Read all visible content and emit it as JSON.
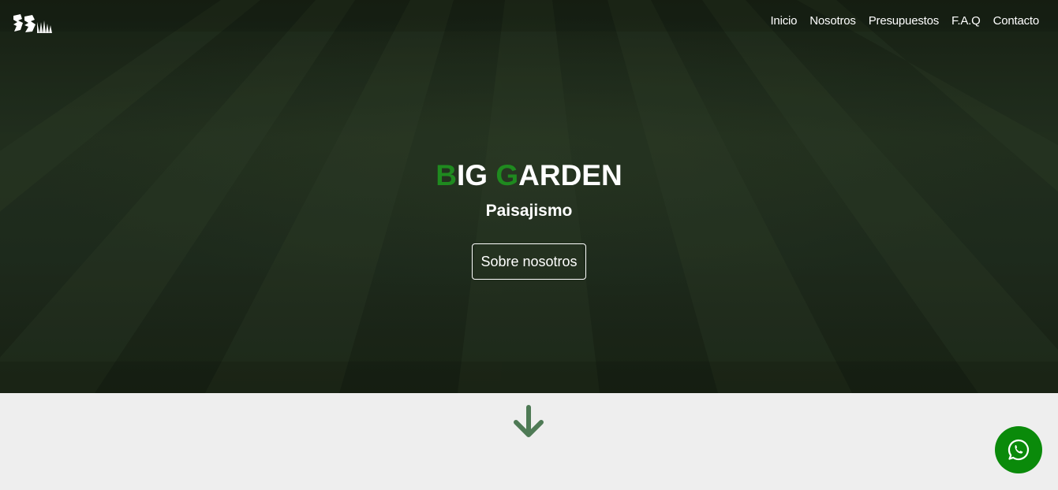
{
  "header": {
    "logo_icon": "big-garden-logo",
    "nav": [
      {
        "label": "Inicio"
      },
      {
        "label": "Nosotros"
      },
      {
        "label": "Presupuestos"
      },
      {
        "label": "F.A.Q"
      },
      {
        "label": "Contacto"
      }
    ]
  },
  "hero": {
    "title_first_initial": "B",
    "title_first_rest": "IG ",
    "title_second_initial": "G",
    "title_second_rest": "ARDEN",
    "subtitle": "Paisajismo",
    "cta_label": "Sobre nosotros"
  },
  "scroll": {
    "icon": "arrow-down-icon"
  },
  "whatsapp": {
    "icon": "whatsapp-icon"
  },
  "colors": {
    "accent_green": "#1f8a1f",
    "whatsapp_green": "#0a8a0a",
    "arrow_green": "#4e7a55",
    "page_background": "#eeeeee"
  }
}
